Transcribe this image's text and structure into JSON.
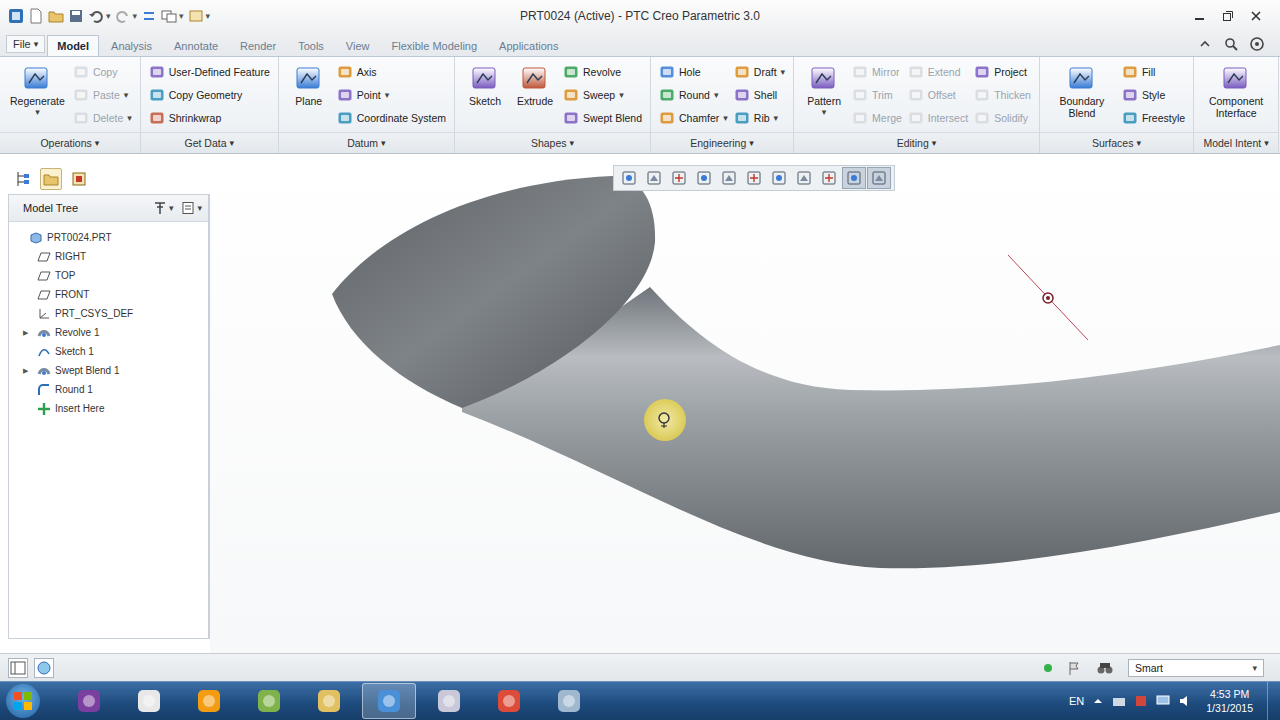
{
  "window": {
    "title": "PRT0024 (Active) - PTC Creo Parametric 3.0"
  },
  "dropdown_glyph": "▾",
  "tabs": [
    {
      "label": "File",
      "selected": false,
      "dropdown": true
    },
    {
      "label": "Model",
      "selected": true,
      "dropdown": false
    },
    {
      "label": "Analysis",
      "selected": false,
      "dropdown": false
    },
    {
      "label": "Annotate",
      "selected": false,
      "dropdown": false
    },
    {
      "label": "Render",
      "selected": false,
      "dropdown": false
    },
    {
      "label": "Tools",
      "selected": false,
      "dropdown": false
    },
    {
      "label": "View",
      "selected": false,
      "dropdown": false
    },
    {
      "label": "Flexible Modeling",
      "selected": false,
      "dropdown": false
    },
    {
      "label": "Applications",
      "selected": false,
      "dropdown": false
    }
  ],
  "ribbon": {
    "groups": [
      {
        "label": "Operations",
        "dropdown": true,
        "columns": [
          {
            "kind": "large",
            "items": [
              {
                "label": "Regenerate",
                "disabled": false,
                "dropdown": true
              }
            ]
          },
          {
            "kind": "stack",
            "items": [
              {
                "label": "Copy",
                "disabled": true,
                "dropdown": false
              },
              {
                "label": "Paste",
                "disabled": true,
                "dropdown": true
              },
              {
                "label": "Delete",
                "disabled": true,
                "dropdown": true
              }
            ]
          }
        ]
      },
      {
        "label": "Get Data",
        "dropdown": true,
        "columns": [
          {
            "kind": "stack",
            "items": [
              {
                "label": "User-Defined Feature",
                "disabled": false,
                "dropdown": false
              },
              {
                "label": "Copy Geometry",
                "disabled": false,
                "dropdown": false
              },
              {
                "label": "Shrinkwrap",
                "disabled": false,
                "dropdown": false
              }
            ]
          }
        ]
      },
      {
        "label": "Datum",
        "dropdown": true,
        "columns": [
          {
            "kind": "large",
            "items": [
              {
                "label": "Plane",
                "disabled": false,
                "dropdown": false
              }
            ]
          },
          {
            "kind": "stack",
            "items": [
              {
                "label": "Axis",
                "disabled": false,
                "dropdown": false
              },
              {
                "label": "Point",
                "disabled": false,
                "dropdown": true
              },
              {
                "label": "Coordinate System",
                "disabled": false,
                "dropdown": false
              }
            ]
          }
        ]
      },
      {
        "label": "Shapes",
        "dropdown": true,
        "columns": [
          {
            "kind": "large",
            "items": [
              {
                "label": "Sketch",
                "disabled": false,
                "dropdown": false
              }
            ]
          },
          {
            "kind": "large",
            "items": [
              {
                "label": "Extrude",
                "disabled": false,
                "dropdown": false
              }
            ]
          },
          {
            "kind": "stack",
            "items": [
              {
                "label": "Revolve",
                "disabled": false,
                "dropdown": false
              },
              {
                "label": "Sweep",
                "disabled": false,
                "dropdown": true
              },
              {
                "label": "Swept Blend",
                "disabled": false,
                "dropdown": false
              }
            ]
          }
        ]
      },
      {
        "label": "Engineering",
        "dropdown": true,
        "columns": [
          {
            "kind": "stack",
            "items": [
              {
                "label": "Hole",
                "disabled": false,
                "dropdown": false
              },
              {
                "label": "Round",
                "disabled": false,
                "dropdown": true
              },
              {
                "label": "Chamfer",
                "disabled": false,
                "dropdown": true
              }
            ]
          },
          {
            "kind": "stack",
            "items": [
              {
                "label": "Draft",
                "disabled": false,
                "dropdown": true
              },
              {
                "label": "Shell",
                "disabled": false,
                "dropdown": false
              },
              {
                "label": "Rib",
                "disabled": false,
                "dropdown": true
              }
            ]
          }
        ]
      },
      {
        "label": "Editing",
        "dropdown": true,
        "columns": [
          {
            "kind": "large",
            "items": [
              {
                "label": "Pattern",
                "disabled": false,
                "dropdown": true
              }
            ]
          },
          {
            "kind": "stack",
            "items": [
              {
                "label": "Mirror",
                "disabled": true,
                "dropdown": false
              },
              {
                "label": "Trim",
                "disabled": true,
                "dropdown": false
              },
              {
                "label": "Merge",
                "disabled": true,
                "dropdown": false
              }
            ]
          },
          {
            "kind": "stack",
            "items": [
              {
                "label": "Extend",
                "disabled": true,
                "dropdown": false
              },
              {
                "label": "Offset",
                "disabled": true,
                "dropdown": false
              },
              {
                "label": "Intersect",
                "disabled": true,
                "dropdown": false
              }
            ]
          },
          {
            "kind": "stack",
            "items": [
              {
                "label": "Project",
                "disabled": false,
                "dropdown": false
              },
              {
                "label": "Thicken",
                "disabled": true,
                "dropdown": false
              },
              {
                "label": "Solidify",
                "disabled": true,
                "dropdown": false
              }
            ]
          }
        ]
      },
      {
        "label": "Surfaces",
        "dropdown": true,
        "columns": [
          {
            "kind": "large",
            "items": [
              {
                "label": "Boundary Blend",
                "disabled": false,
                "dropdown": false
              }
            ]
          },
          {
            "kind": "stack",
            "items": [
              {
                "label": "Fill",
                "disabled": false,
                "dropdown": false
              },
              {
                "label": "Style",
                "disabled": false,
                "dropdown": false
              },
              {
                "label": "Freestyle",
                "disabled": false,
                "dropdown": false
              }
            ]
          }
        ]
      },
      {
        "label": "Model Intent",
        "dropdown": true,
        "columns": [
          {
            "kind": "large",
            "items": [
              {
                "label": "Component Interface",
                "disabled": false,
                "dropdown": false
              }
            ]
          }
        ]
      }
    ]
  },
  "model_tree": {
    "title": "Model Tree",
    "expander_glyph": "▶",
    "items": [
      {
        "label": "PRT0024.PRT",
        "level": 0,
        "kind": "part",
        "expandable": false,
        "expanded": false
      },
      {
        "label": "RIGHT",
        "level": 1,
        "kind": "plane",
        "expandable": false,
        "expanded": false
      },
      {
        "label": "TOP",
        "level": 1,
        "kind": "plane",
        "expandable": false,
        "expanded": false
      },
      {
        "label": "FRONT",
        "level": 1,
        "kind": "plane",
        "expandable": false,
        "expanded": false
      },
      {
        "label": "PRT_CSYS_DEF",
        "level": 1,
        "kind": "csys",
        "expandable": false,
        "expanded": false
      },
      {
        "label": "Revolve 1",
        "level": 1,
        "kind": "feature",
        "expandable": true,
        "expanded": false
      },
      {
        "label": "Sketch 1",
        "level": 1,
        "kind": "sketch",
        "expandable": false,
        "expanded": false
      },
      {
        "label": "Swept Blend 1",
        "level": 1,
        "kind": "feature",
        "expandable": true,
        "expanded": false
      },
      {
        "label": "Round 1",
        "level": 1,
        "kind": "round",
        "expandable": false,
        "expanded": false
      },
      {
        "label": "Insert Here",
        "level": 1,
        "kind": "insert",
        "expandable": false,
        "expanded": false
      }
    ]
  },
  "view_toolbar": [
    {
      "selected": false
    },
    {
      "selected": false
    },
    {
      "selected": false
    },
    {
      "selected": false
    },
    {
      "selected": false
    },
    {
      "selected": false
    },
    {
      "selected": false
    },
    {
      "selected": false
    },
    {
      "selected": false
    },
    {
      "selected": true
    },
    {
      "selected": true
    }
  ],
  "status_bar": {
    "filter": "Smart"
  },
  "taskbar": {
    "apps": [
      {
        "selected": false
      },
      {
        "selected": false
      },
      {
        "selected": false
      },
      {
        "selected": false
      },
      {
        "selected": false
      },
      {
        "selected": true
      },
      {
        "selected": false
      },
      {
        "selected": false
      },
      {
        "selected": false
      }
    ],
    "language": "EN",
    "time": "4:53 PM",
    "date": "1/31/2015"
  }
}
